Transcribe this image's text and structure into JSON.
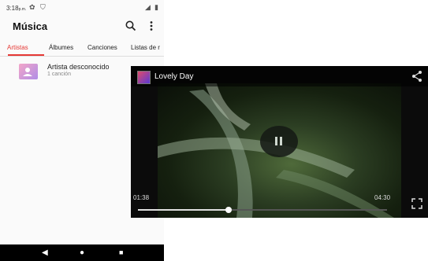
{
  "status": {
    "time": "3:18",
    "ampm": "p.m."
  },
  "appbar": {
    "title": "Música"
  },
  "tabs": [
    {
      "label": "Artistas",
      "active": true
    },
    {
      "label": "Álbumes",
      "active": false
    },
    {
      "label": "Canciones",
      "active": false
    },
    {
      "label": "Listas de r",
      "active": false
    }
  ],
  "artist_row": {
    "name": "Artista desconocido",
    "subtitle": "1 canción"
  },
  "player": {
    "title": "Lovely Day",
    "current_time": "01:38",
    "total_time": "04:30",
    "progress": 0.364
  },
  "colors": {
    "accent": "#e53935",
    "player_bg": "#0b0b0b"
  },
  "icons": [
    "settings-icon",
    "shield-icon",
    "signal-icon",
    "battery-icon",
    "search-icon",
    "more-vert-icon",
    "share-icon",
    "pause-icon",
    "fullscreen-icon",
    "back-icon",
    "home-icon",
    "recents-icon"
  ]
}
